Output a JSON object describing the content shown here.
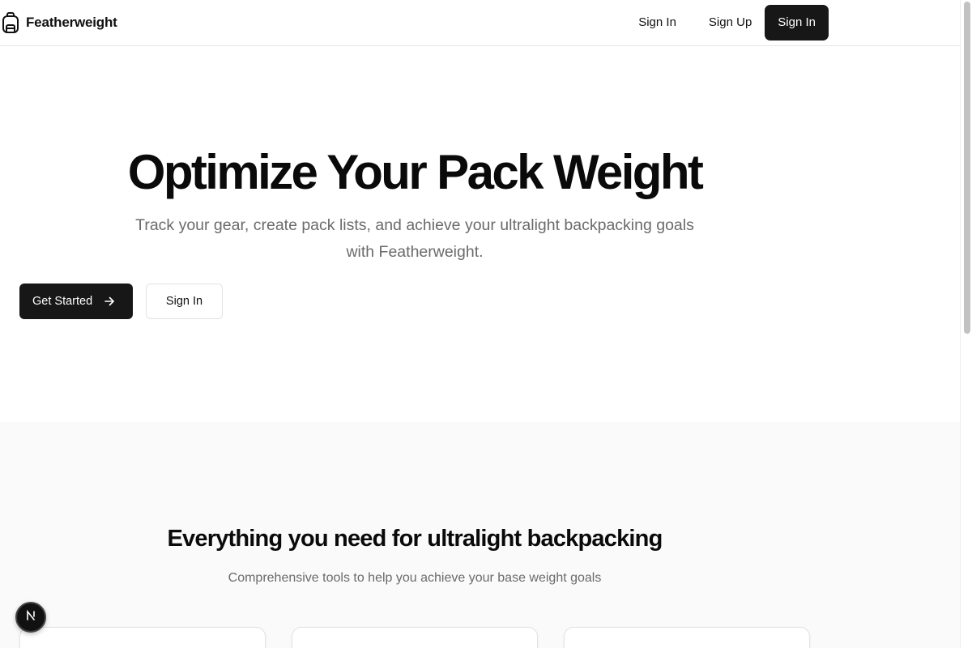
{
  "header": {
    "brand_name": "Featherweight",
    "brand_icon": "backpack-icon",
    "nav": {
      "sign_in_label": "Sign In",
      "sign_up_label": "Sign Up",
      "primary_label": "Sign In"
    }
  },
  "hero": {
    "title": "Optimize Your Pack Weight",
    "subtitle": "Track your gear, create pack lists, and achieve your ultralight backpacking goals with Featherweight.",
    "get_started_label": "Get Started",
    "get_started_icon": "arrow-right-icon",
    "sign_in_label": "Sign In"
  },
  "features": {
    "title": "Everything you need for ultralight backpacking",
    "subtitle": "Comprehensive tools to help you achieve your base weight goals"
  },
  "dev_badge": {
    "icon": "nextjs-n-icon"
  },
  "colors": {
    "primary": "#171717",
    "muted_text": "#6b6b6b",
    "section_bg": "#fafafa",
    "border": "#e5e5e5"
  }
}
